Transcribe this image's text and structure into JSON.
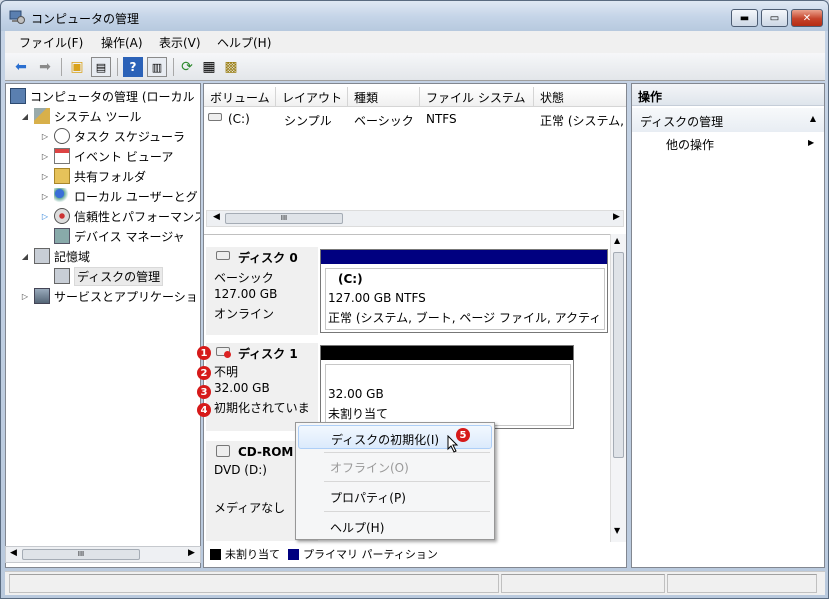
{
  "window": {
    "title": "コンピュータの管理"
  },
  "menu": [
    "ファイル(F)",
    "操作(A)",
    "表示(V)",
    "ヘルプ(H)"
  ],
  "tree": {
    "root": "コンピュータの管理 (ローカル",
    "system_tools": "システム ツール",
    "task_scheduler": "タスク スケジューラ",
    "event_viewer": "イベント ビューア",
    "shared_folders": "共有フォルダ",
    "local_users": "ローカル ユーザーとグ",
    "reliability": "信頼性とパフォーマンス",
    "device_manager": "デバイス マネージャ",
    "storage": "記憶域",
    "disk_management": "ディスクの管理",
    "services_apps": "サービスとアプリケーショ"
  },
  "volume_list": {
    "columns": [
      "ボリューム",
      "レイアウト",
      "種類",
      "ファイル システム",
      "状態"
    ],
    "rows": [
      {
        "volume": "(C:)",
        "layout": "シンプル",
        "type": "ベーシック",
        "fs": "NTFS",
        "status": "正常 (システム,"
      }
    ]
  },
  "disks": {
    "disk0": {
      "name": "ディスク 0",
      "type": "ベーシック",
      "size": "127.00 GB",
      "state": "オンライン",
      "volume": {
        "label": "(C:)",
        "size_fs": "127.00 GB NTFS",
        "status": "正常 (システム, ブート, ページ ファイル, アクティ"
      }
    },
    "disk1": {
      "name": "ディスク 1",
      "type": "不明",
      "size": "32.00 GB",
      "state": "初期化されていま",
      "volume": {
        "size": "32.00 GB",
        "status": "未割り当て"
      }
    },
    "cdrom": {
      "name": "CD-ROM",
      "drive": "DVD (D:)",
      "media": "メディアなし"
    }
  },
  "legend": {
    "unallocated": "未割り当て",
    "primary": "プライマリ パーティション"
  },
  "actions": {
    "header": "操作",
    "section": "ディスクの管理",
    "other": "他の操作"
  },
  "context_menu": {
    "init": "ディスクの初期化(I)",
    "offline": "オフライン(O)",
    "properties": "プロパティ(P)",
    "help": "ヘルプ(H)"
  },
  "badges": [
    "1",
    "2",
    "3",
    "4",
    "5"
  ],
  "scrollbar_thumb": "III",
  "colors": {
    "primary_partition": "#000080",
    "unallocated": "#000000",
    "badge": "#d61a1a"
  }
}
